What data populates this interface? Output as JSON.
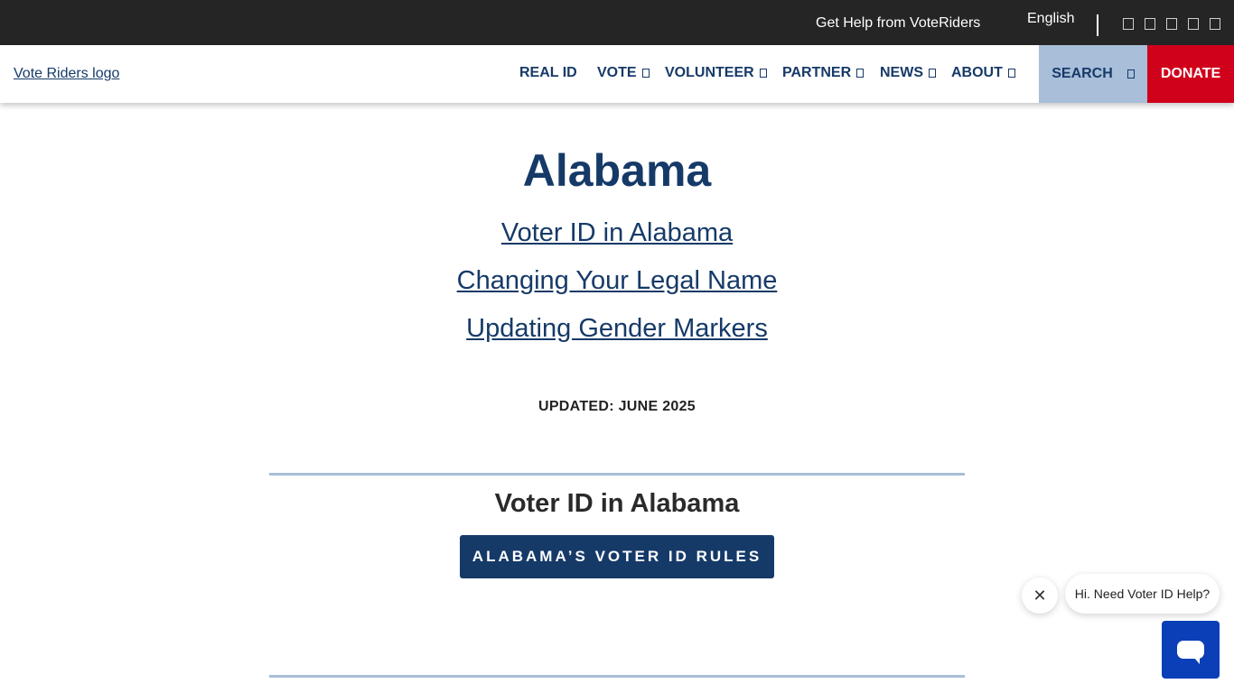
{
  "topbar": {
    "help_link": "Get Help from VoteRiders",
    "language": "English",
    "social_icons": [
      "facebook-icon",
      "twitter-icon",
      "instagram-icon",
      "youtube-icon",
      "linkedin-icon"
    ]
  },
  "header": {
    "logo_alt": "Vote Riders logo",
    "nav": [
      {
        "label": "REAL ID",
        "has_dropdown": false
      },
      {
        "label": "VOTE",
        "has_dropdown": true
      },
      {
        "label": "VOLUNTEER",
        "has_dropdown": true
      },
      {
        "label": "PARTNER",
        "has_dropdown": true
      },
      {
        "label": "NEWS",
        "has_dropdown": true
      },
      {
        "label": "ABOUT",
        "has_dropdown": true
      }
    ],
    "search_label": "SEARCH",
    "donate_label": "DONATE"
  },
  "main": {
    "title": "Alabama",
    "jump_links": [
      "Voter ID in Alabama",
      "Changing Your Legal Name",
      "Updating Gender Markers"
    ],
    "updated": "UPDATED: JUNE 2025",
    "section_title": "Voter ID in Alabama",
    "rules_button": "ALABAMA’S VOTER ID RULES"
  },
  "chat": {
    "close_symbol": "✕",
    "greeting": "Hi. Need Voter ID Help?"
  },
  "colors": {
    "brand_navy": "#163a68",
    "donate_red": "#d0021b",
    "search_bg": "#a8bed9",
    "topbar_bg": "#252525",
    "chat_blue": "#0b3fb8"
  }
}
